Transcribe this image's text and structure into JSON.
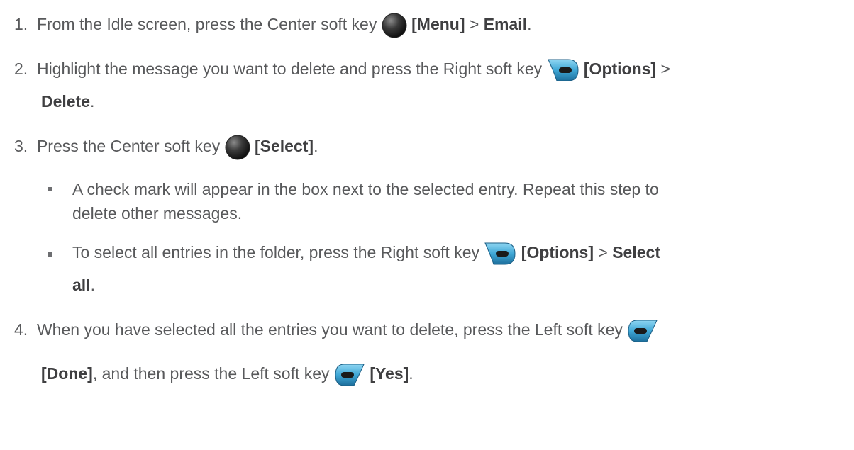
{
  "steps": [
    {
      "number": "1.",
      "text_a": "From the Idle screen, press the Center soft key",
      "key_a": "[Menu]",
      "sep": " > ",
      "dest": "Email",
      "end": "."
    },
    {
      "number": "2.",
      "text_a": "Highlight the message you want to delete and press the Right soft key",
      "key_a": "[Options]",
      "sep": " >",
      "dest": "Delete",
      "end": "."
    },
    {
      "number": "3.",
      "text_a": "Press the Center soft key",
      "key_a": "[Select]",
      "end": "."
    },
    {
      "number": "4.",
      "text_a": "When you have selected all the entries you want to delete, press the Left soft key",
      "key_a": "[Done]",
      "text_b": ", and then press the Left soft key",
      "key_b": "[Yes]",
      "end": "."
    }
  ],
  "bullets": [
    {
      "line1": "A check mark will appear in the box next to the selected entry. Repeat this step to",
      "line2": "delete other messages."
    },
    {
      "text_a": "To select all entries in the folder, press the Right soft key",
      "key_a": "[Options]",
      "sep": " > ",
      "dest_a": "Select",
      "dest_b": "all",
      "end": "."
    }
  ],
  "icons": {
    "center": "center-soft-key-icon",
    "right": "right-soft-key-icon",
    "left": "left-soft-key-icon"
  }
}
